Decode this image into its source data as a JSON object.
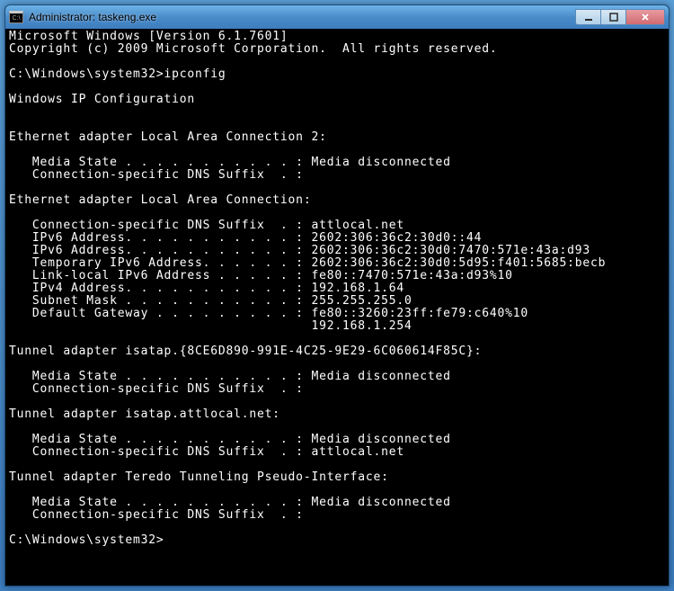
{
  "window": {
    "title": "Administrator: taskeng.exe"
  },
  "console": {
    "lines": [
      "Microsoft Windows [Version 6.1.7601]",
      "Copyright (c) 2009 Microsoft Corporation.  All rights reserved.",
      "",
      "C:\\Windows\\system32>ipconfig",
      "",
      "Windows IP Configuration",
      "",
      "",
      "Ethernet adapter Local Area Connection 2:",
      "",
      "   Media State . . . . . . . . . . . : Media disconnected",
      "   Connection-specific DNS Suffix  . :",
      "",
      "Ethernet adapter Local Area Connection:",
      "",
      "   Connection-specific DNS Suffix  . : attlocal.net",
      "   IPv6 Address. . . . . . . . . . . : 2602:306:36c2:30d0::44",
      "   IPv6 Address. . . . . . . . . . . : 2602:306:36c2:30d0:7470:571e:43a:d93",
      "   Temporary IPv6 Address. . . . . . : 2602:306:36c2:30d0:5d95:f401:5685:becb",
      "   Link-local IPv6 Address . . . . . : fe80::7470:571e:43a:d93%10",
      "   IPv4 Address. . . . . . . . . . . : 192.168.1.64",
      "   Subnet Mask . . . . . . . . . . . : 255.255.255.0",
      "   Default Gateway . . . . . . . . . : fe80::3260:23ff:fe79:c640%10",
      "                                       192.168.1.254",
      "",
      "Tunnel adapter isatap.{8CE6D890-991E-4C25-9E29-6C060614F85C}:",
      "",
      "   Media State . . . . . . . . . . . : Media disconnected",
      "   Connection-specific DNS Suffix  . :",
      "",
      "Tunnel adapter isatap.attlocal.net:",
      "",
      "   Media State . . . . . . . . . . . : Media disconnected",
      "   Connection-specific DNS Suffix  . : attlocal.net",
      "",
      "Tunnel adapter Teredo Tunneling Pseudo-Interface:",
      "",
      "   Media State . . . . . . . . . . . : Media disconnected",
      "   Connection-specific DNS Suffix  . :",
      "",
      "C:\\Windows\\system32>"
    ]
  }
}
